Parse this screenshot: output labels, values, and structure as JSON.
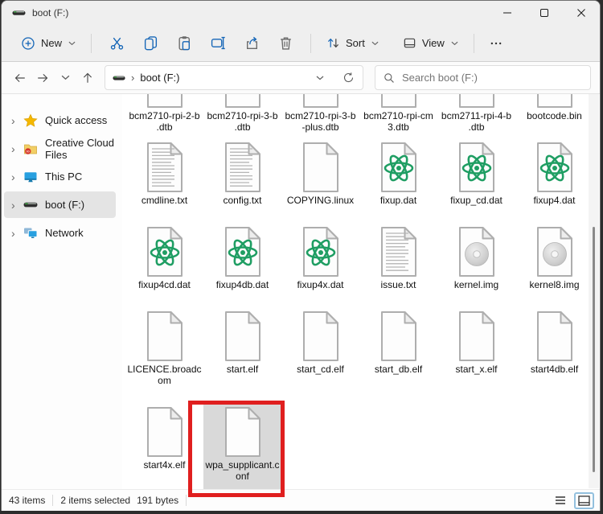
{
  "window": {
    "title": "boot (F:)"
  },
  "toolbar": {
    "new_label": "New",
    "sort_label": "Sort",
    "view_label": "View"
  },
  "navigation": {
    "breadcrumb_drive": "boot (F:)",
    "search_placeholder": "Search boot (F:)"
  },
  "sidebar": {
    "items": [
      {
        "label": "Quick access",
        "icon": "star-icon",
        "selected": false
      },
      {
        "label": "Creative Cloud Files",
        "icon": "creative-cloud-folder-icon",
        "selected": false
      },
      {
        "label": "This PC",
        "icon": "monitor-icon",
        "selected": false
      },
      {
        "label": "boot (F:)",
        "icon": "drive-icon",
        "selected": true
      },
      {
        "label": "Network",
        "icon": "network-icon",
        "selected": false
      }
    ]
  },
  "files": {
    "rows": [
      [
        {
          "label": "bcm2710-rpi-2-b\n.dtb",
          "icon": "doc"
        },
        {
          "label": "bcm2710-rpi-3-b\n.dtb",
          "icon": "doc"
        },
        {
          "label": "bcm2710-rpi-3-b\n-plus.dtb",
          "icon": "doc"
        },
        {
          "label": "bcm2710-rpi-cm\n3.dtb",
          "icon": "doc"
        },
        {
          "label": "bcm2711-rpi-4-b\n.dtb",
          "icon": "doc"
        },
        {
          "label": "bootcode.bin",
          "icon": "doc"
        }
      ],
      [
        {
          "label": "cmdline.txt",
          "icon": "txt"
        },
        {
          "label": "config.txt",
          "icon": "txt"
        },
        {
          "label": "COPYING.linux",
          "icon": "doc"
        },
        {
          "label": "fixup.dat",
          "icon": "atom"
        },
        {
          "label": "fixup_cd.dat",
          "icon": "atom"
        },
        {
          "label": "fixup4.dat",
          "icon": "atom"
        }
      ],
      [
        {
          "label": "fixup4cd.dat",
          "icon": "atom"
        },
        {
          "label": "fixup4db.dat",
          "icon": "atom"
        },
        {
          "label": "fixup4x.dat",
          "icon": "atom"
        },
        {
          "label": "issue.txt",
          "icon": "txt"
        },
        {
          "label": "kernel.img",
          "icon": "disc"
        },
        {
          "label": "kernel8.img",
          "icon": "disc"
        }
      ],
      [
        {
          "label": "LICENCE.broadc\nom",
          "icon": "doc"
        },
        {
          "label": "start.elf",
          "icon": "doc"
        },
        {
          "label": "start_cd.elf",
          "icon": "doc"
        },
        {
          "label": "start_db.elf",
          "icon": "doc"
        },
        {
          "label": "start_x.elf",
          "icon": "doc"
        },
        {
          "label": "start4db.elf",
          "icon": "doc"
        }
      ],
      [
        {
          "label": "start4x.elf",
          "icon": "doc"
        },
        {
          "label": "wpa_supplicant.c\nonf",
          "icon": "doc",
          "selected": true,
          "highlighted": true
        }
      ]
    ]
  },
  "statusbar": {
    "count": "43 items",
    "selected": "2 items selected",
    "size": "191 bytes"
  },
  "colors": {
    "accent_blue": "#1566b7",
    "atom_green": "#1f9e63",
    "highlight_red": "#e01f1f",
    "selection_gray": "#d9d9d9",
    "sidebar_selected": "#e4e4e4",
    "chrome_bg": "#efefef"
  }
}
